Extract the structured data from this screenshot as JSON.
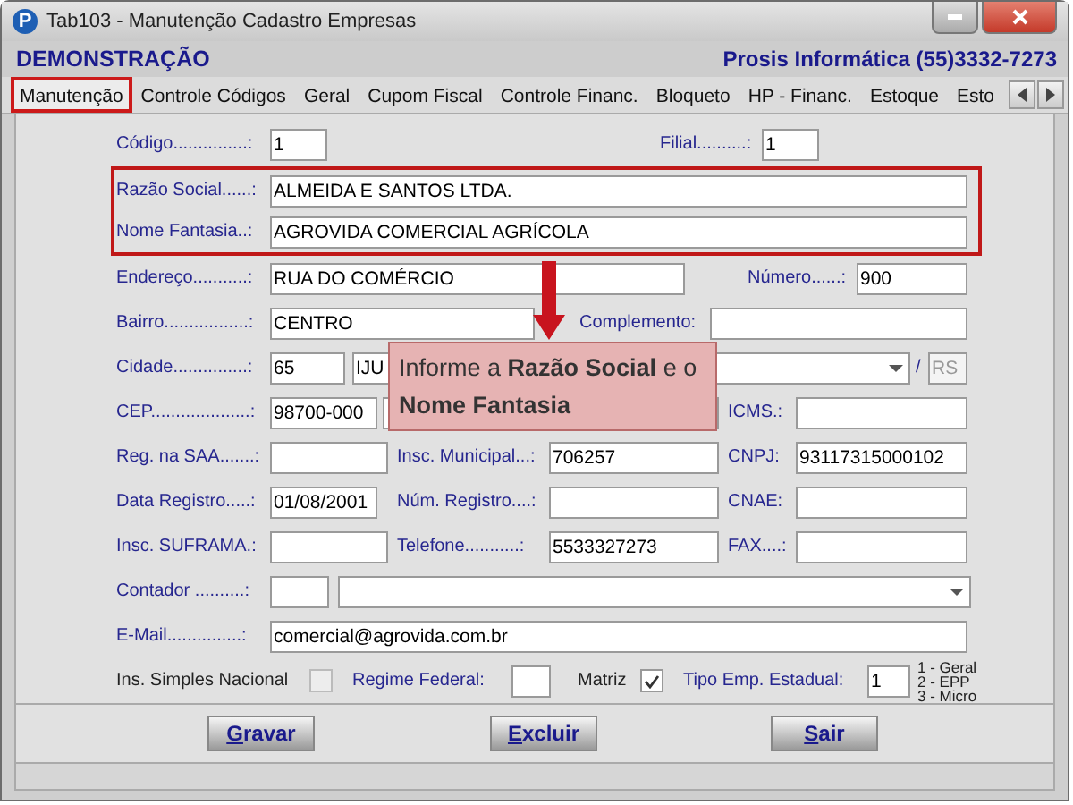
{
  "window": {
    "badge": "P",
    "title": "Tab103 - Manutenção Cadastro Empresas"
  },
  "header": {
    "company": "DEMONSTRAÇÃO",
    "vendor": "Prosis Informática (55)3332-7273"
  },
  "tabs": [
    {
      "label": "Manutenção",
      "selected": true
    },
    {
      "label": "Controle Códigos",
      "selected": false
    },
    {
      "label": "Geral",
      "selected": false
    },
    {
      "label": "Cupom Fiscal",
      "selected": false
    },
    {
      "label": "Controle Financ.",
      "selected": false
    },
    {
      "label": "Bloqueto",
      "selected": false
    },
    {
      "label": "HP - Financ.",
      "selected": false
    },
    {
      "label": "Estoque",
      "selected": false
    },
    {
      "label": "Esto",
      "selected": false
    }
  ],
  "form": {
    "rows": [
      {
        "highlighted": false,
        "items": [
          {
            "kind": "label",
            "text": "Código...............:"
          },
          {
            "kind": "input",
            "value": "1"
          },
          {
            "kind": "label",
            "text": "Filial..........:"
          },
          {
            "kind": "input",
            "value": "1"
          }
        ]
      },
      {
        "highlighted": true,
        "items": [
          {
            "kind": "label",
            "text": "Razão Social......:"
          },
          {
            "kind": "input",
            "value": "ALMEIDA E SANTOS LTDA."
          }
        ]
      },
      {
        "highlighted": true,
        "items": [
          {
            "kind": "label",
            "text": "Nome Fantasia..:"
          },
          {
            "kind": "input",
            "value": "AGROVIDA COMERCIAL AGRÍCOLA"
          }
        ]
      },
      {
        "highlighted": false,
        "items": [
          {
            "kind": "label",
            "text": "Endereço...........:"
          },
          {
            "kind": "input",
            "value": "RUA DO COMÉRCIO"
          },
          {
            "kind": "label",
            "text": "Número......:"
          },
          {
            "kind": "input",
            "value": "900"
          }
        ]
      },
      {
        "highlighted": false,
        "items": [
          {
            "kind": "label",
            "text": "Bairro.................:"
          },
          {
            "kind": "input",
            "value": "CENTRO"
          },
          {
            "kind": "label",
            "text": "Complemento:"
          },
          {
            "kind": "input"
          }
        ]
      },
      {
        "highlighted": false,
        "items": [
          {
            "kind": "label",
            "text": "Cidade...............:"
          },
          {
            "kind": "input",
            "value": "65"
          },
          {
            "kind": "combo",
            "value": "IJU"
          },
          {
            "kind": "label",
            "text": "/"
          },
          {
            "kind": "input",
            "value": "RS",
            "disabled": true
          }
        ]
      },
      {
        "highlighted": false,
        "items": [
          {
            "kind": "label",
            "text": "CEP....................:"
          },
          {
            "kind": "input",
            "value": "98700-000"
          },
          {
            "kind": "input"
          },
          {
            "kind": "label",
            "text": "ICMS.:"
          },
          {
            "kind": "input"
          }
        ]
      },
      {
        "highlighted": false,
        "items": [
          {
            "kind": "label",
            "text": "Reg. na SAA.......:"
          },
          {
            "kind": "input"
          },
          {
            "kind": "label",
            "text": "Insc. Municipal...:"
          },
          {
            "kind": "input",
            "value": "706257"
          },
          {
            "kind": "label",
            "text": "CNPJ:"
          },
          {
            "kind": "input",
            "value": "93117315000102"
          }
        ]
      },
      {
        "highlighted": false,
        "items": [
          {
            "kind": "label",
            "text": "Data Registro.....:"
          },
          {
            "kind": "input",
            "value": "01/08/2001"
          },
          {
            "kind": "label",
            "text": "Núm. Registro....:"
          },
          {
            "kind": "input"
          },
          {
            "kind": "label",
            "text": "CNAE:"
          },
          {
            "kind": "input"
          }
        ]
      },
      {
        "highlighted": false,
        "items": [
          {
            "kind": "label",
            "text": "Insc. SUFRAMA.:"
          },
          {
            "kind": "input"
          },
          {
            "kind": "label",
            "text": "Telefone...........:"
          },
          {
            "kind": "input",
            "value": "5533327273"
          },
          {
            "kind": "label",
            "text": "FAX....:"
          },
          {
            "kind": "input"
          }
        ]
      },
      {
        "highlighted": false,
        "items": [
          {
            "kind": "label",
            "text": "Contador ..........:"
          },
          {
            "kind": "input"
          },
          {
            "kind": "combo"
          }
        ]
      },
      {
        "highlighted": false,
        "items": [
          {
            "kind": "label",
            "text": "E-Mail...............:"
          },
          {
            "kind": "input",
            "value": "comercial@agrovida.com.br"
          }
        ]
      },
      {
        "highlighted": false,
        "items": [
          {
            "kind": "label",
            "text": "Ins. Simples Nacional",
            "plain": true
          },
          {
            "kind": "checkbox",
            "checked": false
          },
          {
            "kind": "label",
            "text": "Regime Federal:"
          },
          {
            "kind": "input"
          },
          {
            "kind": "label",
            "text": "Matriz",
            "plain": true
          },
          {
            "kind": "checkbox",
            "checked": true
          },
          {
            "kind": "label",
            "text": "Tipo Emp. Estadual:"
          },
          {
            "kind": "input",
            "value": "1"
          },
          {
            "kind": "note",
            "lines": [
              "1 - Geral",
              "2 - EPP",
              "3 - Micro"
            ]
          }
        ]
      }
    ]
  },
  "callout": {
    "text": "Informe a **Razão Social** e o **Nome Fantasia**"
  },
  "buttons": [
    {
      "label": "Gravar"
    },
    {
      "label": "Excluir"
    },
    {
      "label": "Sair"
    }
  ]
}
